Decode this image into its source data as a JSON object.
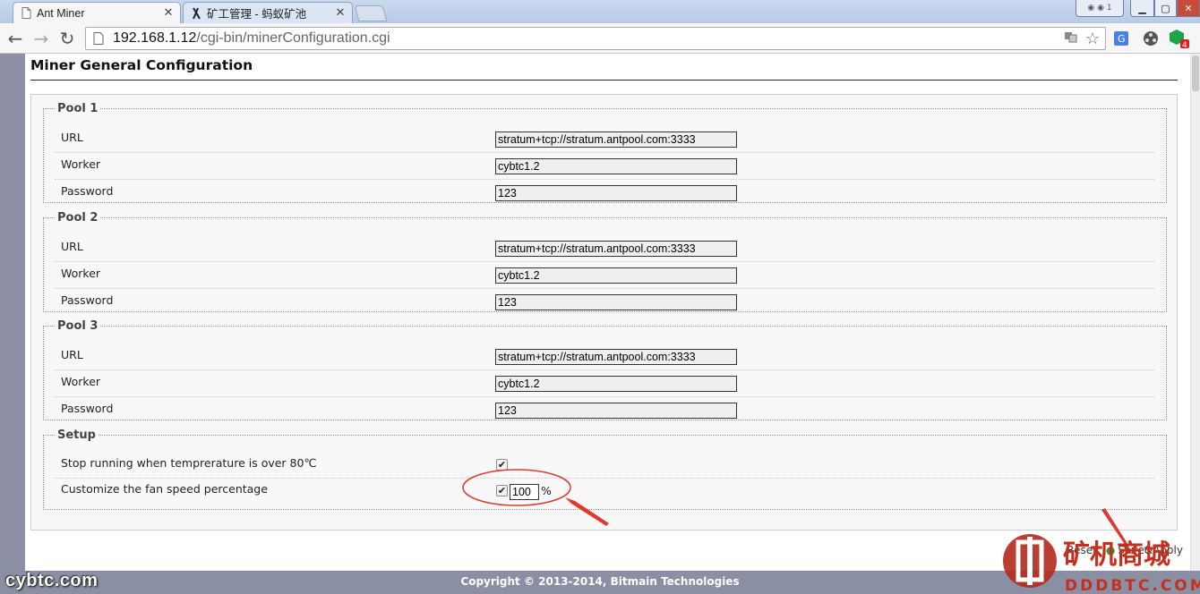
{
  "browser": {
    "tabs": [
      {
        "label": "Ant Miner",
        "active": true
      },
      {
        "label": "矿工管理 - 蚂蚁矿池",
        "active": false
      }
    ],
    "url_host": "192.168.1.12",
    "url_path": "/cgi-bin/minerConfiguration.cgi",
    "extension_badge": "4"
  },
  "page": {
    "title": "Miner General Configuration",
    "pools": [
      {
        "legend": "Pool 1",
        "url_label": "URL",
        "url": "stratum+tcp://stratum.antpool.com:3333",
        "worker_label": "Worker",
        "worker": "cybtc1.2",
        "password_label": "Password",
        "password": "123"
      },
      {
        "legend": "Pool 2",
        "url_label": "URL",
        "url": "stratum+tcp://stratum.antpool.com:3333",
        "worker_label": "Worker",
        "worker": "cybtc1.2",
        "password_label": "Password",
        "password": "123"
      },
      {
        "legend": "Pool 3",
        "url_label": "URL",
        "url": "stratum+tcp://stratum.antpool.com:3333",
        "worker_label": "Worker",
        "worker": "cybtc1.2",
        "password_label": "Password",
        "password": "123"
      }
    ],
    "setup": {
      "legend": "Setup",
      "temp_label": "Stop running when temprerature is over 80℃",
      "temp_checked": true,
      "fan_label": "Customize the fan speed percentage",
      "fan_checked": true,
      "fan_value": "100",
      "fan_unit": "%"
    },
    "buttons": {
      "reset": "Reset",
      "save": "Save&Apply"
    },
    "footer": "Copyright © 2013-2014, Bitmain Technologies"
  },
  "watermarks": {
    "left": "cybtc.com",
    "right_cn": "矿机商城",
    "right_en": "DDDBTC.COM"
  },
  "colors": {
    "annotation": "#e03a30",
    "page_bg": "#8a8fa3"
  }
}
